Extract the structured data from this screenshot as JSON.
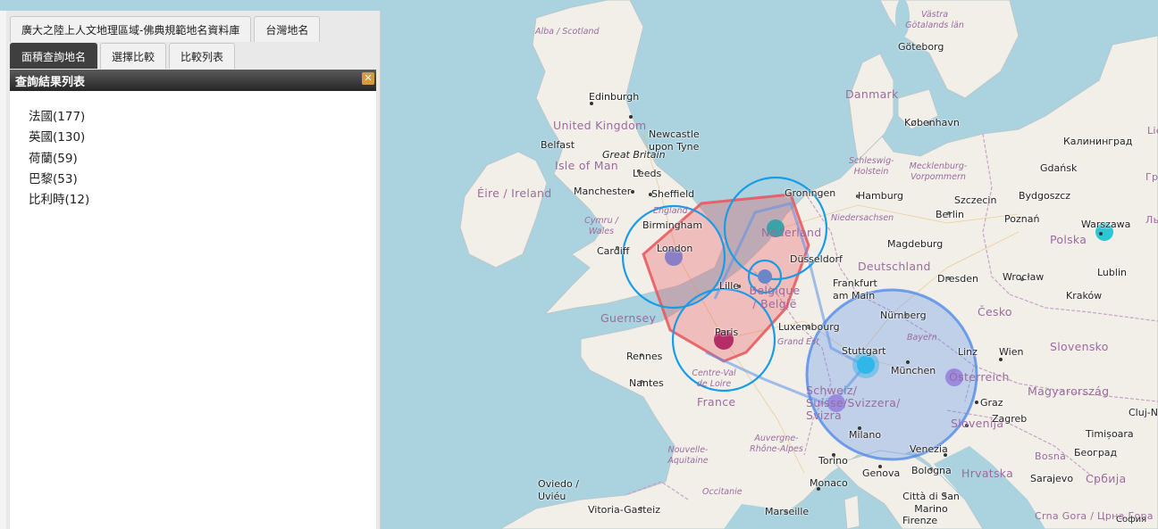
{
  "panel": {
    "top_tabs": [
      "廣大之陸上人文地理區域-佛典規範地名資料庫",
      "台灣地名"
    ],
    "sub_tabs": [
      "面積查詢地名",
      "選擇比較",
      "比較列表"
    ],
    "result_header": "查詢結果列表",
    "close_glyph": "✕",
    "results": [
      "法國(177)",
      "英國(130)",
      "荷蘭(59)",
      "巴黎(53)",
      "比利時(12)"
    ]
  },
  "map": {
    "colors": {
      "sea": "#aad3df",
      "land": "#f2efe9",
      "circle_stroke": "#1a9be6",
      "polygon": "#e8555a",
      "route": "#5b8fe8"
    },
    "labels": {
      "countries": [
        "United Kingdom",
        "Éire / Ireland",
        "France",
        "Nederland",
        "Belgique / België",
        "Deutschland",
        "Danmark",
        "Polska",
        "Česko",
        "Slovensko",
        "Magyarország",
        "Österreich",
        "Schweiz/ Suisse/Svizzera/ Svizra",
        "Slovenija",
        "Hrvatska",
        "Србија",
        "Bosna",
        "Crna Gora / Црна Гора",
        "Guernsey"
      ],
      "regions": [
        "Alba / Scotland",
        "England",
        "Cymru / Wales",
        "Schleswig-Holstein",
        "Mecklenburg-Vorpommern",
        "Niedersachsen",
        "Bayern",
        "Grand Est",
        "Centre-Val de Loire",
        "Nouvelle-Aquitaine",
        "Auvergne-Rhône-Alpes",
        "Occitanie",
        "Västra Götalands län",
        "Great Britain"
      ],
      "cities": [
        "Edinburgh",
        "Newcastle upon Tyne",
        "Belfast",
        "Isle of Man",
        "Leeds",
        "Manchester",
        "Sheffield",
        "Birmingham",
        "Cardiff",
        "London",
        "Lille",
        "Paris",
        "Rennes",
        "Nantes",
        "Oviedo / Uviéu",
        "Vitoria-Gasteiz",
        "Marseille",
        "Monaco",
        "Torino",
        "Genova",
        "Milano",
        "Venezia",
        "Bologna",
        "Città di San Marino",
        "Firenze",
        "Göteborg",
        "København",
        "Hamburg",
        "Groningen",
        "Düsseldorf",
        "Frankfurt am Main",
        "Luxembourg",
        "Stuttgart",
        "München",
        "Nürnberg",
        "Magdeburg",
        "Berlin",
        "Szczecin",
        "Dresden",
        "Wrocław",
        "Poznań",
        "Bydgoszcz",
        "Gdańsk",
        "Калининград",
        "Warszawa",
        "Lublin",
        "Kraków",
        "Linz",
        "Wien",
        "Graz",
        "Zagreb",
        "Timișoara",
        "Београд",
        "Sarajevo",
        "Cluj-N",
        "София",
        "Lie",
        "Гр",
        "Ль"
      ]
    }
  }
}
